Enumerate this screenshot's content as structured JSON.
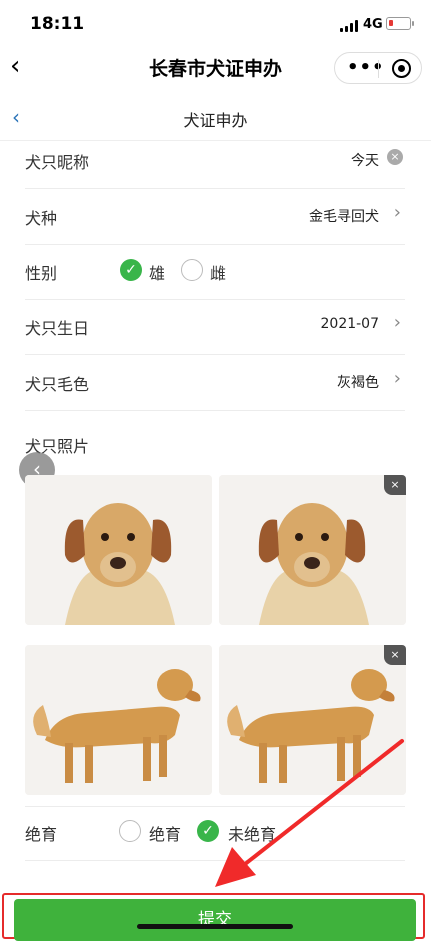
{
  "status": {
    "time": "18:11",
    "network": "4G"
  },
  "nav": {
    "title": "长春市犬证申办"
  },
  "sub_header": {
    "title": "犬证申办"
  },
  "form": {
    "nickname": {
      "label": "犬只昵称",
      "value": "今天",
      "clear_icon": "×"
    },
    "breed": {
      "label": "犬种",
      "value": "金毛寻回犬"
    },
    "gender": {
      "label": "性别",
      "options": [
        "雄",
        "雌"
      ],
      "selected": "雄"
    },
    "birthday": {
      "label": "犬只生日",
      "value": "2021-07"
    },
    "color": {
      "label": "犬只毛色",
      "value": "灰褐色"
    },
    "photos": {
      "label": "犬只照片",
      "delete_icon": "×"
    },
    "sterilization": {
      "label": "绝育",
      "options": [
        "绝育",
        "未绝育"
      ],
      "selected": "未绝育"
    }
  },
  "submit": {
    "label": "提交"
  },
  "icons": {
    "back": "chevron-left-icon",
    "more": "more-icon",
    "close": "close-icon"
  },
  "colors": {
    "accent_green": "#3fb23c",
    "highlight_red": "#e52b2b",
    "link_blue": "#2a73b8"
  }
}
